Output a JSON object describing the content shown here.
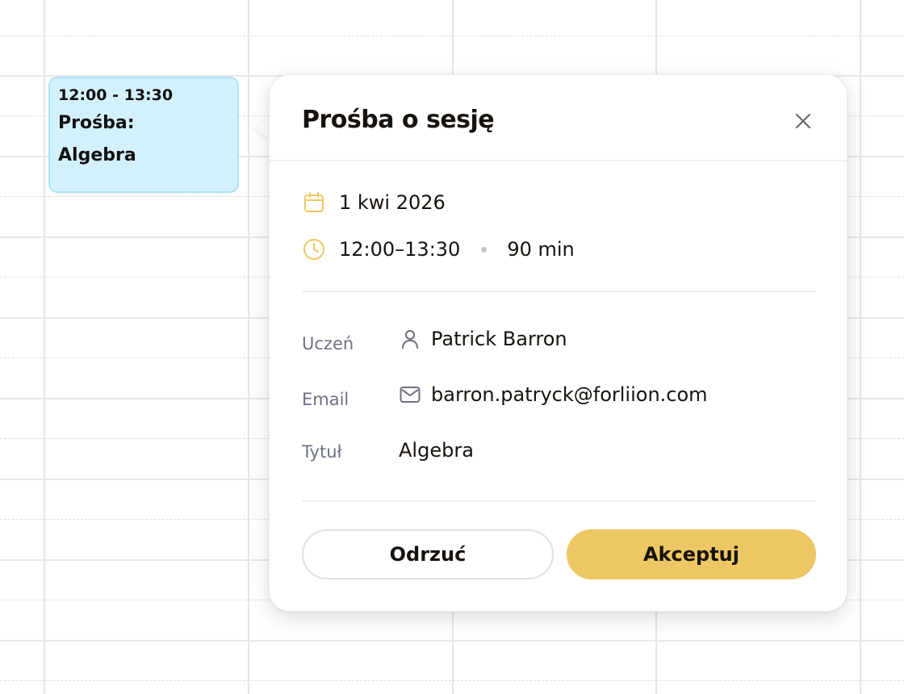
{
  "colors": {
    "event_bg": "#d3f1fc",
    "event_border": "#a9e2f6",
    "accent": "#ecc763",
    "label_gray": "#6b7280"
  },
  "event": {
    "time": "12:00 - 13:30",
    "title": "Prośba:\nAlgebra"
  },
  "popover": {
    "title": "Prośba o sesję",
    "close_icon": "close-icon",
    "date": "1 kwi 2026",
    "date_icon": "calendar-icon",
    "time_range": "12:00–13:30",
    "time_icon": "clock-icon",
    "duration": "90 min",
    "details": {
      "student_label": "Uczeń",
      "student_name": "Patrick Barron",
      "student_icon": "user-icon",
      "email_label": "Email",
      "email": "barron.patryck@forliion.com",
      "email_icon": "mail-icon",
      "title_label": "Tytuł",
      "title_value": "Algebra"
    },
    "buttons": {
      "reject": "Odrzuć",
      "accept": "Akceptuj"
    }
  }
}
